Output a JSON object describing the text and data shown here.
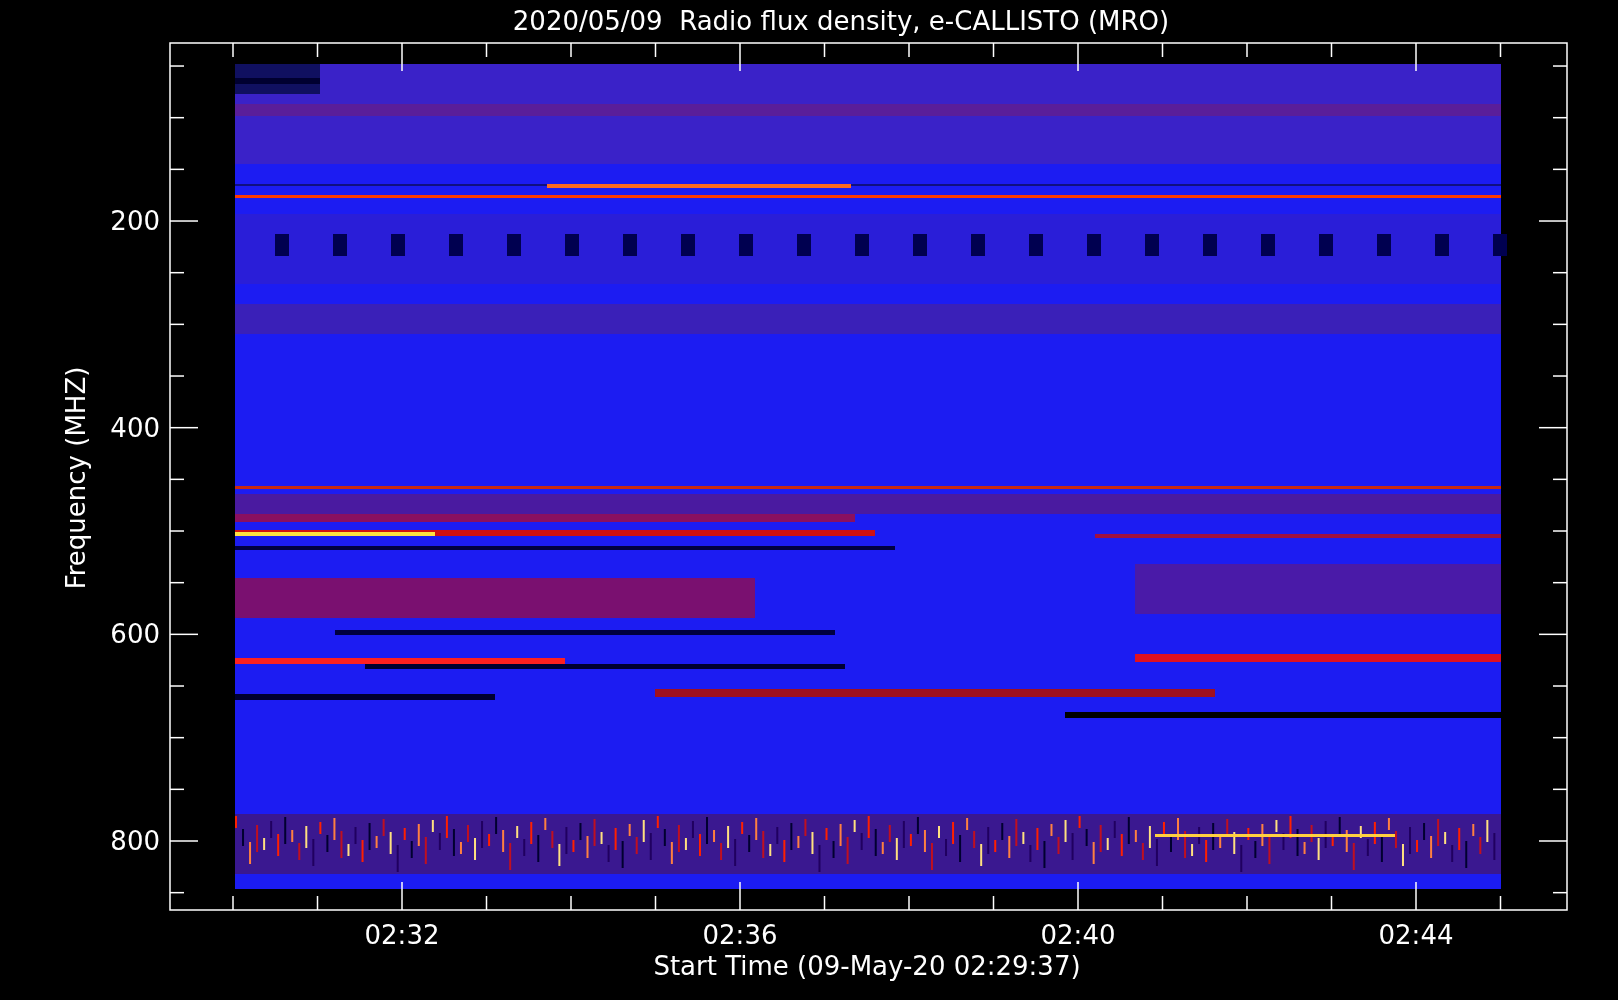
{
  "title": "2020/05/09  Radio flux density, e-CALLISTO (MRO)",
  "y_axis": {
    "label": "Frequency (MHZ)",
    "tick_labels": [
      "200",
      "400",
      "600",
      "800"
    ]
  },
  "x_axis": {
    "label": "Start Time (09-May-20 02:29:37)",
    "tick_labels": [
      "02:32",
      "02:36",
      "02:40",
      "02:44"
    ]
  }
}
